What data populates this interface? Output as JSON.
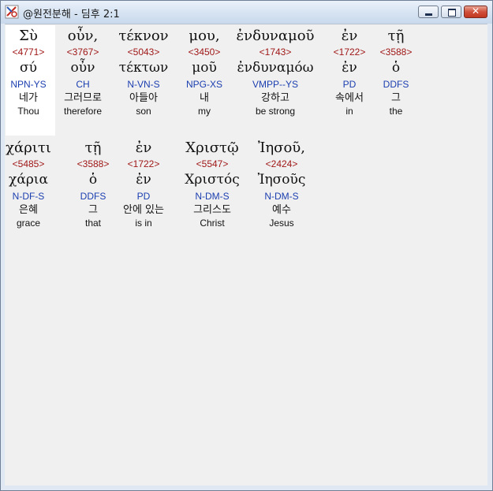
{
  "window": {
    "title": "@원전분해 - 딤후 2:1"
  },
  "title_buttons": {
    "minimize": "minimize",
    "maximize": "maximize",
    "close": "✕"
  },
  "verse_rows": [
    [
      {
        "word": "Σὺ",
        "strongs": "<4771>",
        "lemma": "σύ",
        "parsing": "NPN-YS",
        "korean": "네가",
        "english": "Thou"
      },
      {
        "word": "οὖν,",
        "strongs": "<3767>",
        "lemma": "οὖν",
        "parsing": "CH",
        "korean": "그러므로",
        "english": "therefore"
      },
      {
        "word": "τέκνον",
        "strongs": "<5043>",
        "lemma": "τέκτων",
        "parsing": "N-VN-S",
        "korean": "아들아",
        "english": "son"
      },
      {
        "word": "μου,",
        "strongs": "<3450>",
        "lemma": "μοῦ",
        "parsing": "NPG-XS",
        "korean": "내",
        "english": "my"
      },
      {
        "word": "ἐνδυναμοῦ",
        "strongs": "<1743>",
        "lemma": "ἐνδυναμόω",
        "parsing": "VMPP--YS",
        "korean": "강하고",
        "english": "be strong"
      },
      {
        "word": "ἐν",
        "strongs": "<1722>",
        "lemma": "ἐν",
        "parsing": "PD",
        "korean": "속에서",
        "english": "in"
      },
      {
        "word": "τῇ",
        "strongs": "<3588>",
        "lemma": "ὁ",
        "parsing": "DDFS",
        "korean": "그",
        "english": "the"
      }
    ],
    [
      {
        "word": "χάριτι",
        "strongs": "<5485>",
        "lemma": "χάρια",
        "parsing": "N-DF-S",
        "korean": "은혜",
        "english": "grace"
      },
      {
        "word": "τῇ",
        "strongs": "<3588>",
        "lemma": "ὁ",
        "parsing": "DDFS",
        "korean": "그",
        "english": "that"
      },
      {
        "word": "ἐν",
        "strongs": "<1722>",
        "lemma": "ἐν",
        "parsing": "PD",
        "korean": "안에 있는",
        "english": "is in"
      },
      {
        "word": "Χριστῷ",
        "strongs": "<5547>",
        "lemma": "Χριστός",
        "parsing": "N-DM-S",
        "korean": "그리스도",
        "english": "Christ"
      },
      {
        "word": "Ἰησοῦ,",
        "strongs": "<2424>",
        "lemma": "Ἰησοῦς",
        "parsing": "N-DM-S",
        "korean": "예수",
        "english": "Jesus"
      }
    ]
  ],
  "colors": {
    "strongs": "#a01818",
    "parsing": "#1c3fb0",
    "content_bg": "#f0f0f0",
    "selected_bg": "#ffffff"
  }
}
